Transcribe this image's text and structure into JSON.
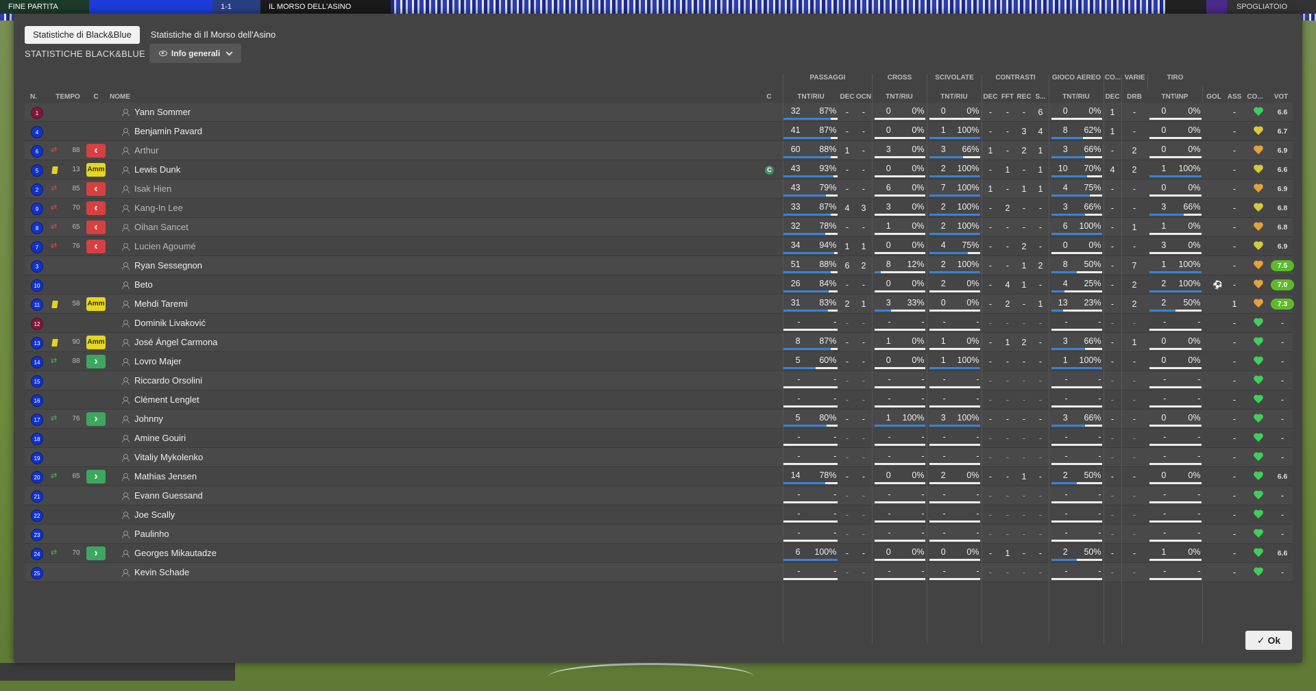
{
  "topbar": {
    "left_label": "FINE PARTITA",
    "team_right": "IL MORSO DELL'ASINO",
    "score": "1-1",
    "right_label": "SPOGLIATOIO"
  },
  "tabs": [
    {
      "label": "Statistiche di Black&Blue",
      "active": true
    },
    {
      "label": "Statistiche di Il Morso dell'Asino",
      "active": false
    }
  ],
  "section_title": "STATISTICHE BLACK&BLUE",
  "view_dropdown": {
    "label": "Info generali",
    "icon": "eye-icon"
  },
  "group_headers": {
    "passaggi": "PASSAGGI",
    "cross": "CROSS",
    "scivolate": "SCIVOLATE",
    "contrasti": "CONTRASTI",
    "gioco_aereo": "GIOCO AEREO",
    "co": "CO...",
    "varie": "VARIE",
    "tiro": "TIRO"
  },
  "column_headers": {
    "n": "N.",
    "tempo": "TEMPO",
    "c": "C",
    "nome": "NOME",
    "cap": "C",
    "pass_tnt": "TNT/RIU",
    "pass_dec": "DEC",
    "pass_ocn": "OCN",
    "cross_tnt": "TNT/RIU",
    "sciv_tnt": "TNT/RIU",
    "cont_dec": "DEC",
    "cont_fft": "FFT",
    "cont_rec": "REC",
    "cont_s": "S...",
    "aereo_tnt": "TNT/RIU",
    "co_dec": "DEC",
    "varie_drb": "DRB",
    "tiro_tnt": "TNT\\INP",
    "gol": "GOL",
    "ass": "ASS",
    "cond": "CO...",
    "voto": "VOT"
  },
  "players": [
    {
      "n": "1",
      "gk": true,
      "event": "",
      "min": "",
      "status": "",
      "name": "Yann Sommer",
      "captain": false,
      "played": true,
      "pass": [
        "32",
        "87%",
        87
      ],
      "pdec": "-",
      "pocn": "-",
      "cross": [
        "0",
        "0%",
        0
      ],
      "sciv": [
        "0",
        "0%",
        0
      ],
      "cdec": "-",
      "cfft": "-",
      "crec": "-",
      "cs": "6",
      "aereo": [
        "0",
        "0%",
        0
      ],
      "codec": "1",
      "drb": "-",
      "tiro": [
        "0",
        "0%",
        0
      ],
      "gol": "",
      "ass": "-",
      "heart": "green",
      "voto": "6.6",
      "good": false
    },
    {
      "n": "4",
      "gk": false,
      "event": "",
      "min": "",
      "status": "",
      "name": "Benjamin Pavard",
      "captain": false,
      "played": true,
      "pass": [
        "41",
        "87%",
        87
      ],
      "pdec": "-",
      "pocn": "-",
      "cross": [
        "0",
        "0%",
        0
      ],
      "sciv": [
        "1",
        "100%",
        100
      ],
      "cdec": "-",
      "cfft": "-",
      "crec": "3",
      "cs": "4",
      "aereo": [
        "8",
        "62%",
        62
      ],
      "codec": "1",
      "drb": "-",
      "tiro": [
        "0",
        "0%",
        0
      ],
      "gol": "",
      "ass": "-",
      "heart": "yellow",
      "voto": "6.7",
      "good": false
    },
    {
      "n": "6",
      "gk": false,
      "event": "sub-out",
      "min": "88",
      "status": "subout",
      "name": "Arthur",
      "captain": false,
      "played": true,
      "out": true,
      "pass": [
        "60",
        "88%",
        88
      ],
      "pdec": "1",
      "pocn": "-",
      "cross": [
        "3",
        "0%",
        0
      ],
      "sciv": [
        "3",
        "66%",
        66
      ],
      "cdec": "1",
      "cfft": "-",
      "crec": "2",
      "cs": "1",
      "aereo": [
        "3",
        "66%",
        66
      ],
      "codec": "-",
      "drb": "2",
      "tiro": [
        "0",
        "0%",
        0
      ],
      "gol": "",
      "ass": "-",
      "heart": "orange",
      "voto": "6.9",
      "good": false
    },
    {
      "n": "5",
      "gk": false,
      "event": "yellow",
      "min": "13",
      "status": "amm",
      "name": "Lewis Dunk",
      "captain": true,
      "played": true,
      "pass": [
        "43",
        "93%",
        93
      ],
      "pdec": "-",
      "pocn": "-",
      "cross": [
        "0",
        "0%",
        0
      ],
      "sciv": [
        "2",
        "100%",
        100
      ],
      "cdec": "-",
      "cfft": "1",
      "crec": "-",
      "cs": "1",
      "aereo": [
        "10",
        "70%",
        70
      ],
      "codec": "4",
      "drb": "2",
      "tiro": [
        "1",
        "100%",
        100
      ],
      "gol": "",
      "ass": "-",
      "heart": "yellow",
      "voto": "6.6",
      "good": false
    },
    {
      "n": "2",
      "gk": false,
      "event": "sub-out",
      "min": "85",
      "status": "subout",
      "name": "Isak Hien",
      "captain": false,
      "played": true,
      "out": true,
      "pass": [
        "43",
        "79%",
        79
      ],
      "pdec": "-",
      "pocn": "-",
      "cross": [
        "6",
        "0%",
        0
      ],
      "sciv": [
        "7",
        "100%",
        100
      ],
      "cdec": "1",
      "cfft": "-",
      "crec": "1",
      "cs": "1",
      "aereo": [
        "4",
        "75%",
        75
      ],
      "codec": "-",
      "drb": "-",
      "tiro": [
        "0",
        "0%",
        0
      ],
      "gol": "",
      "ass": "-",
      "heart": "orange",
      "voto": "6.9",
      "good": false
    },
    {
      "n": "9",
      "gk": false,
      "event": "sub-out",
      "min": "70",
      "status": "subout",
      "name": "Kang-In Lee",
      "captain": false,
      "played": true,
      "out": true,
      "pass": [
        "33",
        "87%",
        87
      ],
      "pdec": "4",
      "pocn": "3",
      "cross": [
        "3",
        "0%",
        0
      ],
      "sciv": [
        "2",
        "100%",
        100
      ],
      "cdec": "-",
      "cfft": "2",
      "crec": "-",
      "cs": "-",
      "aereo": [
        "3",
        "66%",
        66
      ],
      "codec": "-",
      "drb": "-",
      "tiro": [
        "3",
        "66%",
        66
      ],
      "gol": "",
      "ass": "-",
      "heart": "yellow",
      "voto": "6.8",
      "good": false
    },
    {
      "n": "8",
      "gk": false,
      "event": "sub-out",
      "min": "65",
      "status": "subout",
      "name": "Oihan Sancet",
      "captain": false,
      "played": true,
      "out": true,
      "pass": [
        "32",
        "78%",
        78
      ],
      "pdec": "-",
      "pocn": "-",
      "cross": [
        "1",
        "0%",
        0
      ],
      "sciv": [
        "2",
        "100%",
        100
      ],
      "cdec": "-",
      "cfft": "-",
      "crec": "-",
      "cs": "-",
      "aereo": [
        "6",
        "100%",
        100
      ],
      "codec": "-",
      "drb": "1",
      "tiro": [
        "1",
        "0%",
        0
      ],
      "gol": "",
      "ass": "-",
      "heart": "orange",
      "voto": "6.8",
      "good": false
    },
    {
      "n": "7",
      "gk": false,
      "event": "sub-out",
      "min": "76",
      "status": "subout",
      "name": "Lucien Agoumé",
      "captain": false,
      "played": true,
      "out": true,
      "pass": [
        "34",
        "94%",
        94
      ],
      "pdec": "1",
      "pocn": "1",
      "cross": [
        "0",
        "0%",
        0
      ],
      "sciv": [
        "4",
        "75%",
        75
      ],
      "cdec": "-",
      "cfft": "-",
      "crec": "2",
      "cs": "-",
      "aereo": [
        "0",
        "0%",
        0
      ],
      "codec": "-",
      "drb": "-",
      "tiro": [
        "3",
        "0%",
        0
      ],
      "gol": "",
      "ass": "-",
      "heart": "yellow",
      "voto": "6.9",
      "good": false
    },
    {
      "n": "3",
      "gk": false,
      "event": "",
      "min": "",
      "status": "",
      "name": "Ryan Sessegnon",
      "captain": false,
      "played": true,
      "pass": [
        "51",
        "88%",
        88
      ],
      "pdec": "6",
      "pocn": "2",
      "cross": [
        "8",
        "12%",
        12
      ],
      "sciv": [
        "2",
        "100%",
        100
      ],
      "cdec": "-",
      "cfft": "-",
      "crec": "1",
      "cs": "2",
      "aereo": [
        "8",
        "50%",
        50
      ],
      "codec": "-",
      "drb": "7",
      "tiro": [
        "1",
        "100%",
        100
      ],
      "gol": "",
      "ass": "-",
      "heart": "orange",
      "voto": "7.5",
      "good": true
    },
    {
      "n": "10",
      "gk": false,
      "event": "",
      "min": "",
      "status": "",
      "name": "Beto",
      "captain": false,
      "played": true,
      "pass": [
        "26",
        "84%",
        84
      ],
      "pdec": "-",
      "pocn": "-",
      "cross": [
        "0",
        "0%",
        0
      ],
      "sciv": [
        "2",
        "0%",
        0
      ],
      "cdec": "-",
      "cfft": "4",
      "crec": "1",
      "cs": "-",
      "aereo": [
        "4",
        "25%",
        25
      ],
      "codec": "-",
      "drb": "2",
      "tiro": [
        "2",
        "100%",
        100
      ],
      "gol": "⚽",
      "ass": "-",
      "heart": "orange",
      "voto": "7.0",
      "good": true
    },
    {
      "n": "11",
      "gk": false,
      "event": "yellow",
      "min": "58",
      "status": "amm",
      "name": "Mehdi Taremi",
      "captain": false,
      "played": true,
      "pass": [
        "31",
        "83%",
        83
      ],
      "pdec": "2",
      "pocn": "1",
      "cross": [
        "3",
        "33%",
        33
      ],
      "sciv": [
        "0",
        "0%",
        0
      ],
      "cdec": "-",
      "cfft": "2",
      "crec": "-",
      "cs": "1",
      "aereo": [
        "13",
        "23%",
        23
      ],
      "codec": "-",
      "drb": "2",
      "tiro": [
        "2",
        "50%",
        50
      ],
      "gol": "",
      "ass": "1",
      "heart": "orange",
      "voto": "7.3",
      "good": true
    },
    {
      "n": "12",
      "gk": true,
      "event": "",
      "min": "",
      "status": "",
      "name": "Dominik Livaković",
      "captain": false,
      "played": false,
      "gol": "",
      "ass": "-",
      "heart": "green",
      "voto": "-",
      "good": false
    },
    {
      "n": "13",
      "gk": false,
      "event": "yellow",
      "min": "90",
      "status": "amm",
      "name": "José Ángel Carmona",
      "captain": false,
      "played": true,
      "pass": [
        "8",
        "87%",
        87
      ],
      "pdec": "-",
      "pocn": "-",
      "cross": [
        "1",
        "0%",
        0
      ],
      "sciv": [
        "1",
        "0%",
        0
      ],
      "cdec": "-",
      "cfft": "1",
      "crec": "2",
      "cs": "-",
      "aereo": [
        "3",
        "66%",
        66
      ],
      "codec": "-",
      "drb": "1",
      "tiro": [
        "0",
        "0%",
        0
      ],
      "gol": "",
      "ass": "-",
      "heart": "green",
      "voto": "-",
      "good": false
    },
    {
      "n": "14",
      "gk": false,
      "event": "sub-in",
      "min": "88",
      "status": "subin",
      "name": "Lovro Majer",
      "captain": false,
      "played": true,
      "pass": [
        "5",
        "60%",
        60
      ],
      "pdec": "-",
      "pocn": "-",
      "cross": [
        "0",
        "0%",
        0
      ],
      "sciv": [
        "1",
        "100%",
        100
      ],
      "cdec": "-",
      "cfft": "-",
      "crec": "-",
      "cs": "-",
      "aereo": [
        "1",
        "100%",
        100
      ],
      "codec": "-",
      "drb": "-",
      "tiro": [
        "0",
        "0%",
        0
      ],
      "gol": "",
      "ass": "-",
      "heart": "green",
      "voto": "-",
      "good": false
    },
    {
      "n": "15",
      "gk": false,
      "event": "",
      "min": "",
      "status": "",
      "name": "Riccardo Orsolini",
      "captain": false,
      "played": false,
      "gol": "",
      "ass": "-",
      "heart": "green",
      "voto": "-",
      "good": false
    },
    {
      "n": "16",
      "gk": false,
      "event": "",
      "min": "",
      "status": "",
      "name": "Clément Lenglet",
      "captain": false,
      "played": false,
      "gol": "",
      "ass": "-",
      "heart": "green",
      "voto": "-",
      "good": false
    },
    {
      "n": "17",
      "gk": false,
      "event": "sub-in",
      "min": "76",
      "status": "subin",
      "name": "Johnny",
      "captain": false,
      "played": true,
      "pass": [
        "5",
        "80%",
        80
      ],
      "pdec": "-",
      "pocn": "-",
      "cross": [
        "1",
        "100%",
        100
      ],
      "sciv": [
        "3",
        "100%",
        100
      ],
      "cdec": "-",
      "cfft": "-",
      "crec": "-",
      "cs": "-",
      "aereo": [
        "3",
        "66%",
        66
      ],
      "codec": "-",
      "drb": "-",
      "tiro": [
        "0",
        "0%",
        0
      ],
      "gol": "",
      "ass": "-",
      "heart": "green",
      "voto": "-",
      "good": false
    },
    {
      "n": "18",
      "gk": false,
      "event": "",
      "min": "",
      "status": "",
      "name": "Amine Gouiri",
      "captain": false,
      "played": false,
      "gol": "",
      "ass": "-",
      "heart": "green",
      "voto": "-",
      "good": false
    },
    {
      "n": "19",
      "gk": false,
      "event": "",
      "min": "",
      "status": "",
      "name": "Vitaliy Mykolenko",
      "captain": false,
      "played": false,
      "gol": "",
      "ass": "-",
      "heart": "green",
      "voto": "-",
      "good": false
    },
    {
      "n": "20",
      "gk": false,
      "event": "sub-in",
      "min": "65",
      "status": "subin",
      "name": "Mathias Jensen",
      "captain": false,
      "played": true,
      "pass": [
        "14",
        "78%",
        78
      ],
      "pdec": "-",
      "pocn": "-",
      "cross": [
        "0",
        "0%",
        0
      ],
      "sciv": [
        "2",
        "0%",
        0
      ],
      "cdec": "-",
      "cfft": "-",
      "crec": "1",
      "cs": "-",
      "aereo": [
        "2",
        "50%",
        50
      ],
      "codec": "-",
      "drb": "-",
      "tiro": [
        "0",
        "0%",
        0
      ],
      "gol": "",
      "ass": "-",
      "heart": "green",
      "voto": "6.6",
      "good": false
    },
    {
      "n": "21",
      "gk": false,
      "event": "",
      "min": "",
      "status": "",
      "name": "Evann Guessand",
      "captain": false,
      "played": false,
      "gol": "",
      "ass": "-",
      "heart": "green",
      "voto": "-",
      "good": false
    },
    {
      "n": "22",
      "gk": false,
      "event": "",
      "min": "",
      "status": "",
      "name": "Joe Scally",
      "captain": false,
      "played": false,
      "gol": "",
      "ass": "-",
      "heart": "green",
      "voto": "-",
      "good": false
    },
    {
      "n": "23",
      "gk": false,
      "event": "",
      "min": "",
      "status": "",
      "name": "Paulinho",
      "captain": false,
      "played": false,
      "gol": "",
      "ass": "-",
      "heart": "green",
      "voto": "-",
      "good": false
    },
    {
      "n": "24",
      "gk": false,
      "event": "sub-in",
      "min": "70",
      "status": "subin",
      "name": "Georges Mikautadze",
      "captain": false,
      "played": true,
      "pass": [
        "6",
        "100%",
        100
      ],
      "pdec": "-",
      "pocn": "-",
      "cross": [
        "0",
        "0%",
        0
      ],
      "sciv": [
        "0",
        "0%",
        0
      ],
      "cdec": "-",
      "cfft": "1",
      "crec": "-",
      "cs": "-",
      "aereo": [
        "2",
        "50%",
        50
      ],
      "codec": "-",
      "drb": "-",
      "tiro": [
        "1",
        "0%",
        0
      ],
      "gol": "",
      "ass": "-",
      "heart": "green",
      "voto": "6.6",
      "good": false
    },
    {
      "n": "25",
      "gk": false,
      "event": "",
      "min": "",
      "status": "",
      "name": "Kevin Schade",
      "captain": false,
      "played": false,
      "gol": "",
      "ass": "-",
      "heart": "green",
      "voto": "-",
      "good": false
    }
  ],
  "labels": {
    "amm": "Amm",
    "captain": "C",
    "dash": "-"
  },
  "ok_button": "Ok"
}
